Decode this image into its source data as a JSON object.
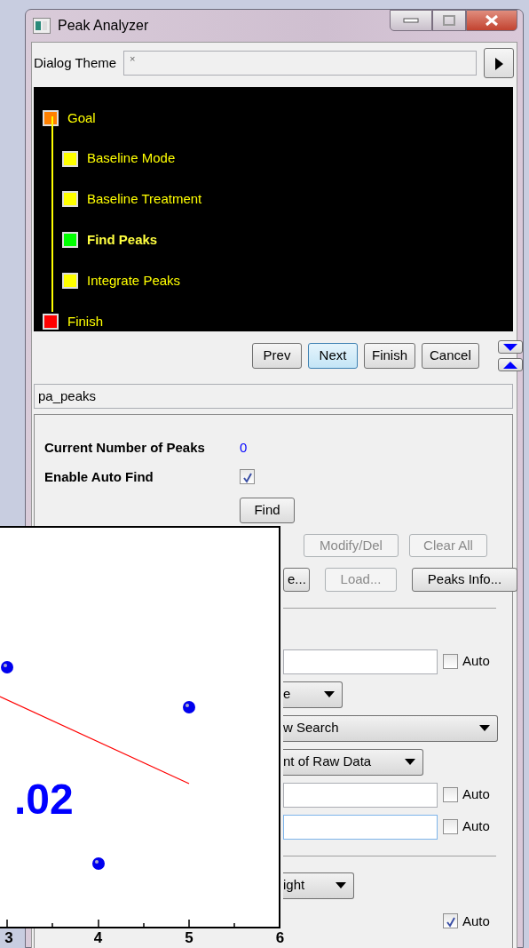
{
  "window": {
    "title": "Peak Analyzer"
  },
  "theme": {
    "label": "Dialog Theme",
    "value": "×"
  },
  "tree": [
    {
      "label": "Goal",
      "color": "#ff8000",
      "selected": false,
      "children": [
        {
          "label": "Baseline Mode",
          "color": "#ffff00",
          "selected": false
        },
        {
          "label": "Baseline Treatment",
          "color": "#ffff00",
          "selected": false
        },
        {
          "label": "Find Peaks",
          "color": "#00ff00",
          "selected": true
        },
        {
          "label": "Integrate Peaks",
          "color": "#ffff00",
          "selected": false
        }
      ]
    },
    {
      "label": "Finish",
      "color": "#ff0000",
      "selected": false
    }
  ],
  "nav_buttons": [
    {
      "label": "Prev",
      "focused": false
    },
    {
      "label": "Next",
      "focused": true
    },
    {
      "label": "Finish",
      "focused": false
    },
    {
      "label": "Cancel",
      "focused": false
    }
  ],
  "page_name": "pa_peaks",
  "peaks": {
    "count_label": "Current Number of Peaks",
    "count": "0",
    "auto_find_label": "Enable Auto Find",
    "auto_find_checked": true,
    "find_button": "Find"
  },
  "button_rows": [
    [
      {
        "label": "Modify/Del",
        "disabled": true
      },
      {
        "label": "Clear All",
        "disabled": true
      }
    ],
    [
      {
        "label": "e...",
        "disabled": false
      },
      {
        "label": "Load...",
        "disabled": true
      },
      {
        "label": "Peaks Info...",
        "disabled": false
      }
    ]
  ],
  "settings": [
    {
      "kind": "separator"
    },
    {
      "kind": "field",
      "focused": false,
      "auto": {
        "label": "Auto",
        "checked": false
      }
    },
    {
      "kind": "dropdown",
      "value": "e"
    },
    {
      "kind": "dropdown",
      "value": "w Search"
    },
    {
      "kind": "dropdown",
      "value": "nt of Raw Data"
    },
    {
      "kind": "field",
      "focused": false,
      "auto": {
        "label": "Auto",
        "checked": false
      }
    },
    {
      "kind": "field",
      "focused": true,
      "auto": {
        "label": "Auto",
        "checked": false
      }
    },
    {
      "kind": "separator"
    },
    {
      "kind": "dropdown",
      "value": "ight"
    },
    {
      "kind": "checkbox",
      "auto": {
        "label": "Auto",
        "checked": true
      }
    }
  ],
  "graph": {
    "big_label": ".02",
    "x_tick_labels": [
      "3",
      "4",
      "5",
      "6"
    ]
  }
}
